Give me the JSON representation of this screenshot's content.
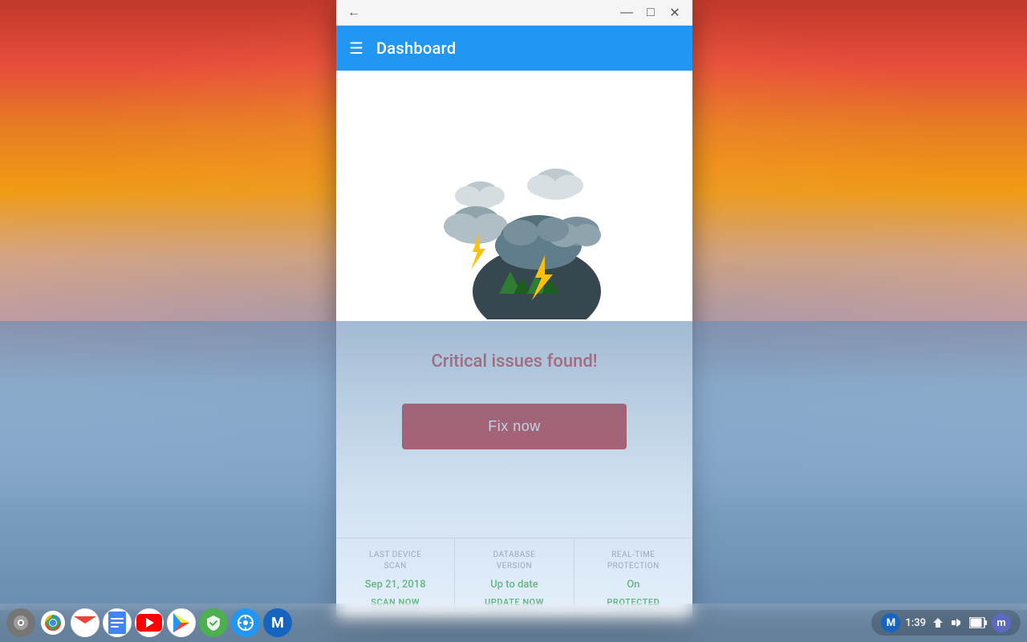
{
  "desktop": {
    "label": "Chrome OS Desktop"
  },
  "window": {
    "title_bar": {
      "back_label": "←",
      "minimize_label": "—",
      "maximize_label": "□",
      "close_label": "✕"
    },
    "header": {
      "title": "Dashboard",
      "menu_icon": "☰"
    },
    "main": {
      "critical_text": "Critical issues found!",
      "fix_button_label": "Fix now"
    },
    "footer": {
      "stats": [
        {
          "label": "LAST DEVICE\nSCAN",
          "value": "Sep 21, 2018",
          "action": "SCAN NOW"
        },
        {
          "label": "DATABASE\nVERSION",
          "value": "Up to date",
          "action": "UPDATE NOW"
        },
        {
          "label": "REAL-TIME\nPROTECTION",
          "value": "On",
          "action": "PROTECTED"
        }
      ]
    }
  },
  "taskbar": {
    "apps": [
      {
        "name": "chrome-settings",
        "icon": "⚙",
        "bg": "#757575"
      },
      {
        "name": "chrome-browser",
        "icon": "●",
        "bg": "#4285F4"
      },
      {
        "name": "gmail",
        "icon": "✉",
        "bg": "#EA4335"
      },
      {
        "name": "docs",
        "icon": "📄",
        "bg": "#4285F4"
      },
      {
        "name": "youtube",
        "icon": "▶",
        "bg": "#FF0000"
      },
      {
        "name": "play-store",
        "icon": "▷",
        "bg": "#00BCD4"
      },
      {
        "name": "security",
        "icon": "🛡",
        "bg": "#4CAF50"
      },
      {
        "name": "settings2",
        "icon": "⚙",
        "bg": "#2196F3"
      },
      {
        "name": "malwarebytes",
        "icon": "M",
        "bg": "#1565C0"
      }
    ],
    "system_tray": {
      "mail_icon": "M",
      "time": "1:39",
      "network_icon": "↑↓",
      "battery_icon": "▮",
      "account_icon": "m"
    }
  },
  "colors": {
    "header_blue": "#2196F3",
    "fix_button_red": "#c62828",
    "critical_red": "#e53935",
    "green": "#4CAF50",
    "stat_label_gray": "#9e9e9e"
  }
}
